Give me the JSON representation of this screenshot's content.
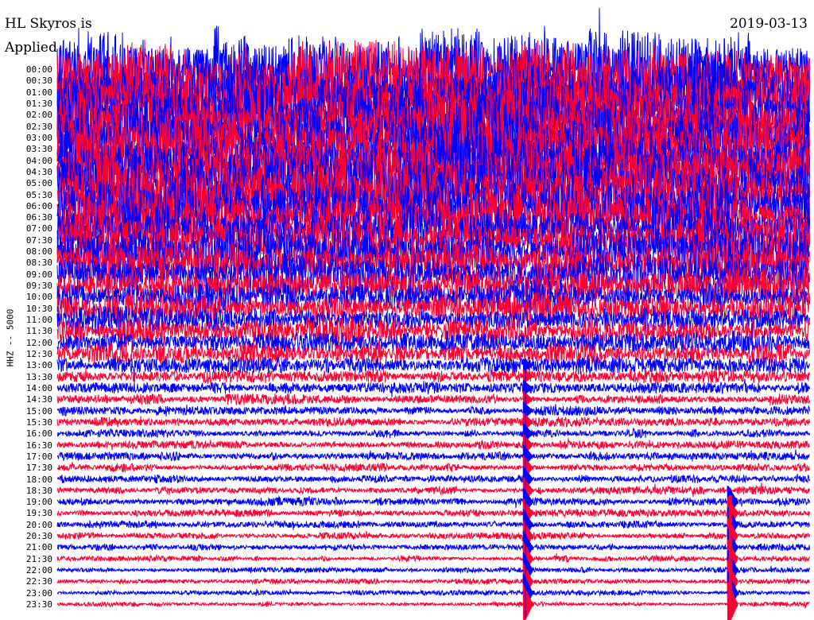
{
  "header": {
    "station": "HL Skyros is",
    "date": "2019-03-13",
    "note": "Applied"
  },
  "chart_data": {
    "type": "line",
    "title": "HL Skyros is",
    "date": "2019-03-13",
    "ylabel": "HHZ -- 5000",
    "y_tick_labels": [
      "00:00",
      "00:30",
      "01:00",
      "01:30",
      "02:00",
      "02:30",
      "03:00",
      "03:30",
      "04:00",
      "04:30",
      "05:00",
      "05:30",
      "06:00",
      "06:30",
      "07:00",
      "07:30",
      "08:00",
      "08:30",
      "09:00",
      "09:30",
      "10:00",
      "10:30",
      "11:00",
      "11:30",
      "12:00",
      "12:30",
      "13:00",
      "13:30",
      "14:00",
      "14:30",
      "15:00",
      "15:30",
      "16:00",
      "16:30",
      "17:00",
      "17:30",
      "18:00",
      "18:30",
      "19:00",
      "19:30",
      "20:00",
      "20:30",
      "21:00",
      "21:30",
      "22:00",
      "22:30",
      "23:00",
      "23:30"
    ],
    "trace_colors": [
      "#0000ff",
      "#ff0033"
    ],
    "relative_noise_amplitude": [
      3.0,
      2.9,
      2.8,
      2.8,
      2.8,
      2.7,
      2.7,
      2.6,
      2.6,
      2.5,
      2.4,
      2.3,
      2.2,
      2.1,
      2.0,
      1.9,
      1.75,
      1.6,
      1.5,
      1.35,
      1.25,
      1.15,
      1.05,
      0.95,
      0.85,
      0.75,
      0.65,
      0.55,
      0.45,
      0.4,
      0.36,
      0.34,
      0.33,
      0.32,
      0.31,
      0.3,
      0.3,
      0.29,
      0.3,
      0.28,
      0.27,
      0.25,
      0.24,
      0.22,
      0.2,
      0.19,
      0.18,
      0.17
    ],
    "events": [
      {
        "start": "13:00",
        "end": "23:59",
        "position_fraction": 0.623,
        "relative_amplitude": 1.0,
        "label": ""
      },
      {
        "start": "19:00",
        "end": "23:59",
        "position_fraction": 0.895,
        "relative_amplitude": 2.5,
        "label": ""
      }
    ]
  }
}
